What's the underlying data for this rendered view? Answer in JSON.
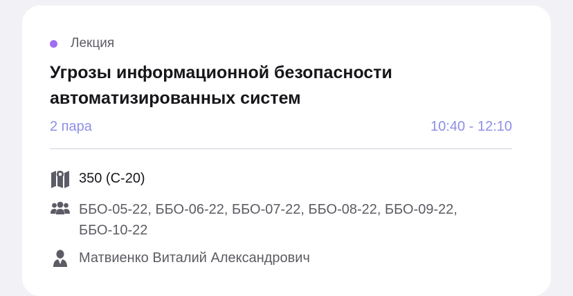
{
  "lesson": {
    "type_label": "Лекция",
    "type_color": "#a06df2",
    "title": "Угрозы информационной безопасности автоматизированных систем",
    "pair": "2 пара",
    "time": "10:40 - 12:10",
    "accent_color": "#8c8fe8"
  },
  "details": {
    "room": {
      "icon": "map-icon",
      "text": "350 (С-20)"
    },
    "groups": {
      "icon": "group-icon",
      "text": "ББО-05-22, ББО-06-22, ББО-07-22, ББО-08-22, ББО-09-22, ББО-10-22"
    },
    "teacher": {
      "icon": "person-icon",
      "text": "Матвиенко Виталий Александрович"
    }
  }
}
